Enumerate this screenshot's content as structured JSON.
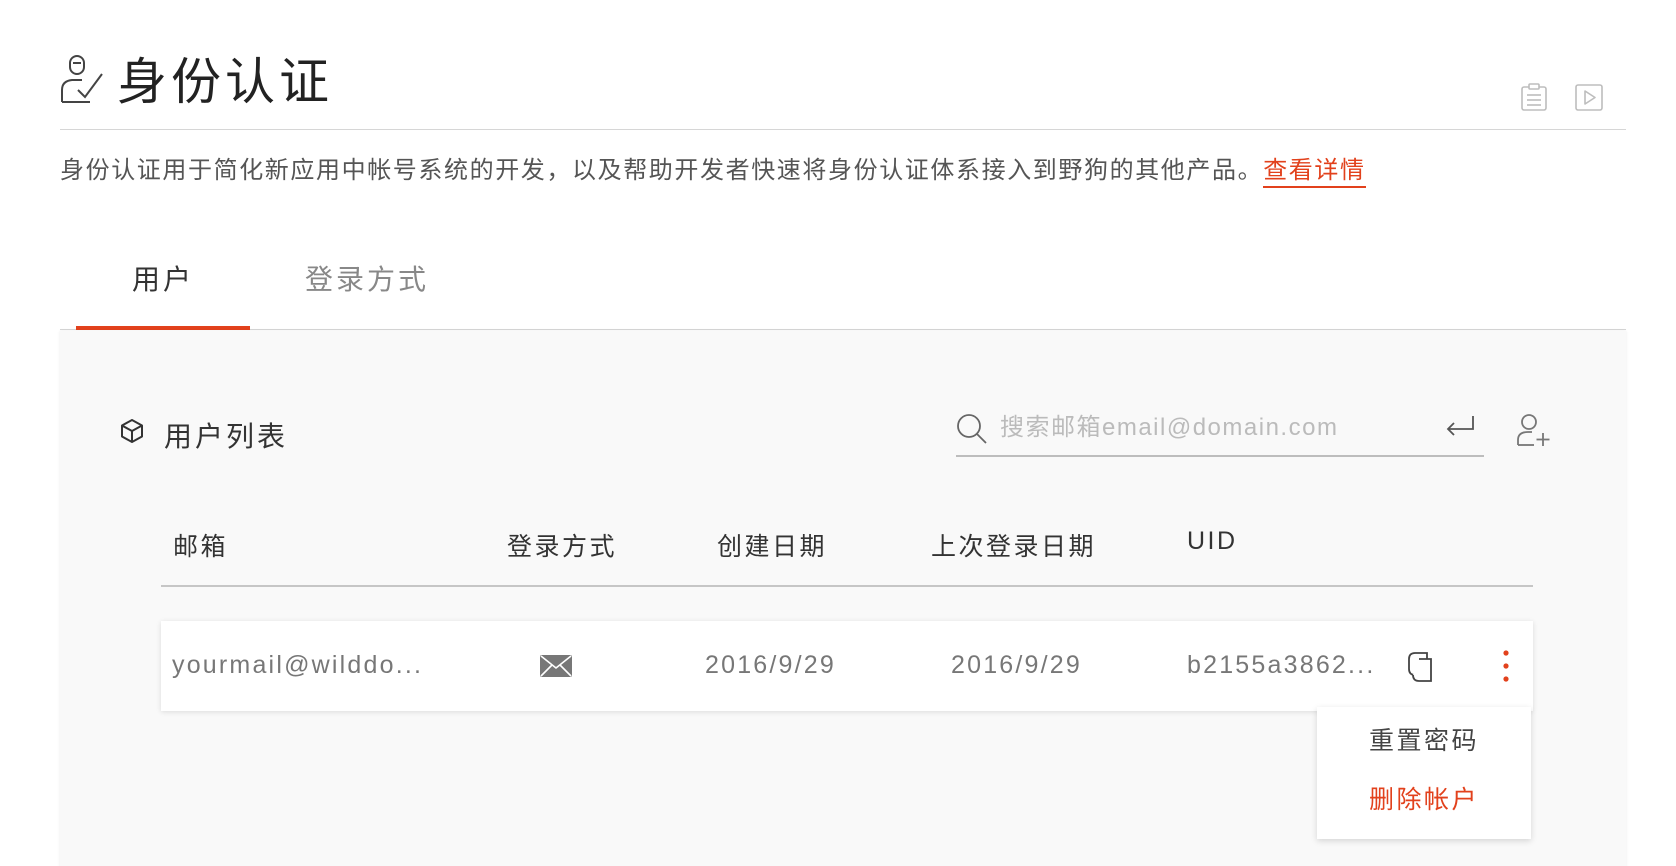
{
  "header": {
    "title": "身份认证",
    "description": "身份认证用于简化新应用中帐号系统的开发，以及帮助开发者快速将身份认证体系接入到野狗的其他产品。",
    "details_link": "查看详情",
    "icons": [
      "user-check-icon",
      "document-icon",
      "play-icon"
    ]
  },
  "tabs": [
    {
      "label": "用户",
      "active": true
    },
    {
      "label": "登录方式",
      "active": false
    }
  ],
  "user_list": {
    "title": "用户列表",
    "search_placeholder": "搜索邮箱email@domain.com",
    "columns": [
      "邮箱",
      "登录方式",
      "创建日期",
      "上次登录日期",
      "UID"
    ],
    "rows": [
      {
        "email": "yourmail@wilddo...",
        "login_method": "mail-icon",
        "created": "2016/9/29",
        "last_login": "2016/9/29",
        "uid": "b2155a3862..."
      }
    ],
    "row_menu": [
      "重置密码",
      "删除帐户"
    ]
  },
  "colors": {
    "accent": "#e2411c",
    "panel_bg": "#f9f9f9",
    "text": "#333333",
    "muted": "#777777"
  }
}
